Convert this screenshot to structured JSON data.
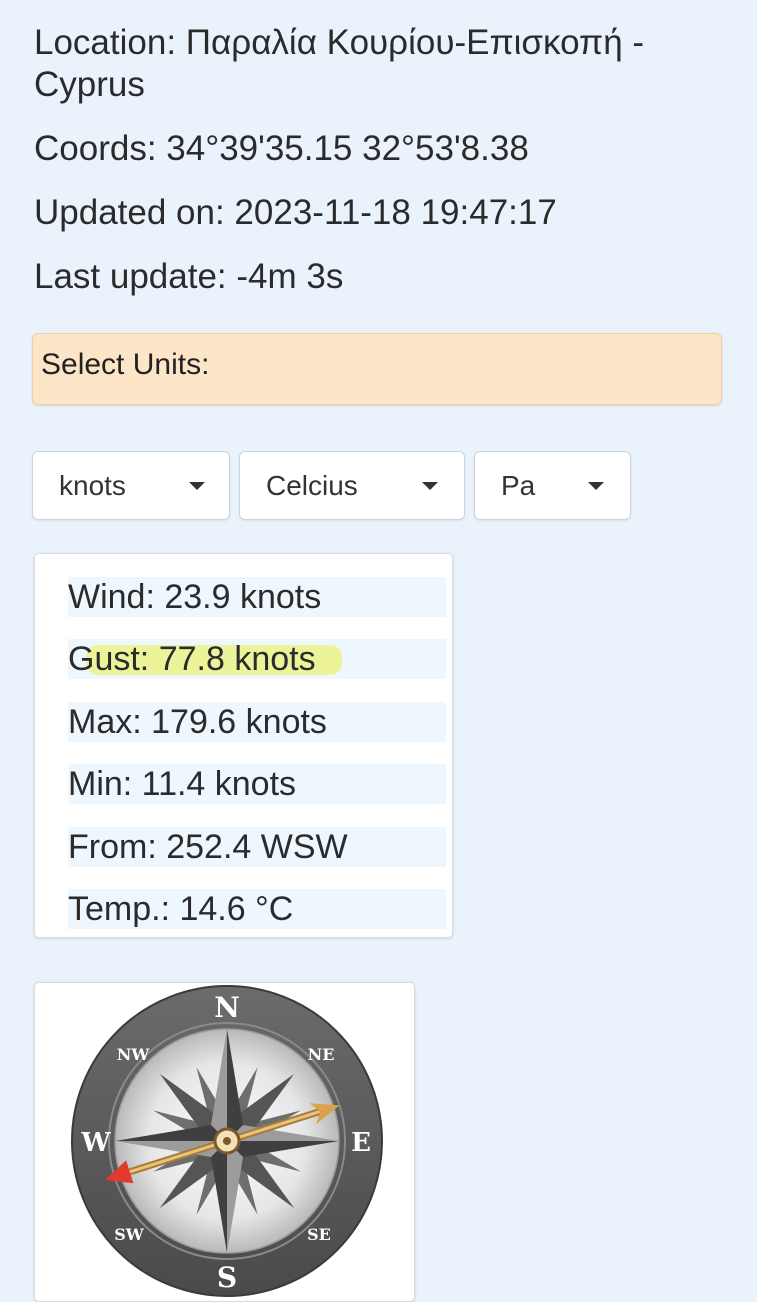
{
  "station": {
    "location": "Location: Παραλία Κουρίου-Επισκοπή - Cyprus",
    "coords": "Coords: 34°39'35.15 32°53'8.38",
    "updated_on": "Updated on: 2023-11-18 19:47:17",
    "last_update": "Last update: -4m 3s"
  },
  "units": {
    "banner_label": "Select Units:",
    "wind_unit": "knots",
    "temp_unit": "Celcius",
    "pressure_unit": "Pa"
  },
  "readings": {
    "wind": "Wind: 23.9 knots",
    "gust": "Gust: 77.8 knots",
    "max": "Max: 179.6 knots",
    "min": "Min: 11.4 knots",
    "from": "From: 252.4 WSW",
    "temp": "Temp.: 14.6 °C"
  },
  "compass": {
    "n": "N",
    "ne": "NE",
    "e": "E",
    "se": "SE",
    "s": "S",
    "sw": "SW",
    "w": "W",
    "nw": "NW",
    "direction_deg": 252.4
  },
  "colors": {
    "page_background": "#eaf3fc",
    "banner_background": "#fde5c8",
    "row_background": "#eef6fe",
    "highlight": "#ecf046",
    "needle_tip": "#e03a2f"
  }
}
